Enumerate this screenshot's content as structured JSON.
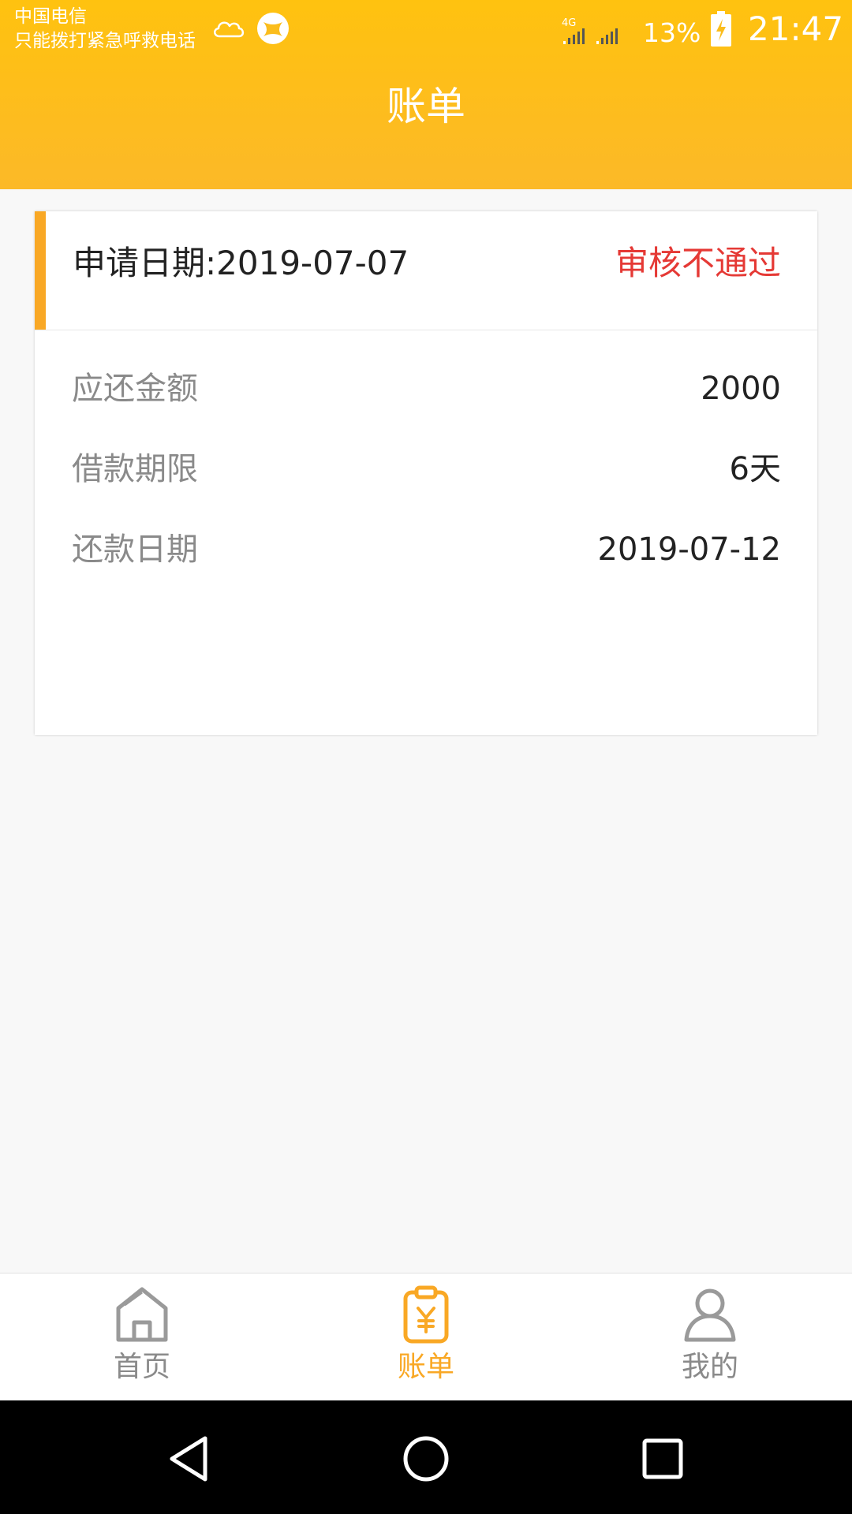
{
  "status_bar": {
    "carrier": "中国电信",
    "carrier_note": "只能拨打紧急呼救电话",
    "network": "4G",
    "battery_percent": "13%",
    "time": "21:47"
  },
  "header": {
    "title": "账单"
  },
  "bill_card": {
    "apply_date": "申请日期:2019-07-07",
    "status": "审核不通过",
    "status_color": "#e53935",
    "accent_color": "#f9a825",
    "rows": [
      {
        "label": "应还金额",
        "value": "2000"
      },
      {
        "label": "借款期限",
        "value": "6天"
      },
      {
        "label": "还款日期",
        "value": "2019-07-12"
      }
    ]
  },
  "tabbar": {
    "active_color": "#f9a825",
    "items": [
      {
        "label": "首页",
        "icon": "home-icon",
        "active": false
      },
      {
        "label": "账单",
        "icon": "bill-icon",
        "active": true
      },
      {
        "label": "我的",
        "icon": "user-icon",
        "active": false
      }
    ]
  },
  "system_nav": {
    "buttons": [
      "back-icon",
      "home-circle-icon",
      "recents-icon"
    ]
  },
  "colors": {
    "header_gradient_top": "#ffc20f",
    "header_gradient_bottom": "#fcb928",
    "page_background": "#f8f8f8"
  }
}
